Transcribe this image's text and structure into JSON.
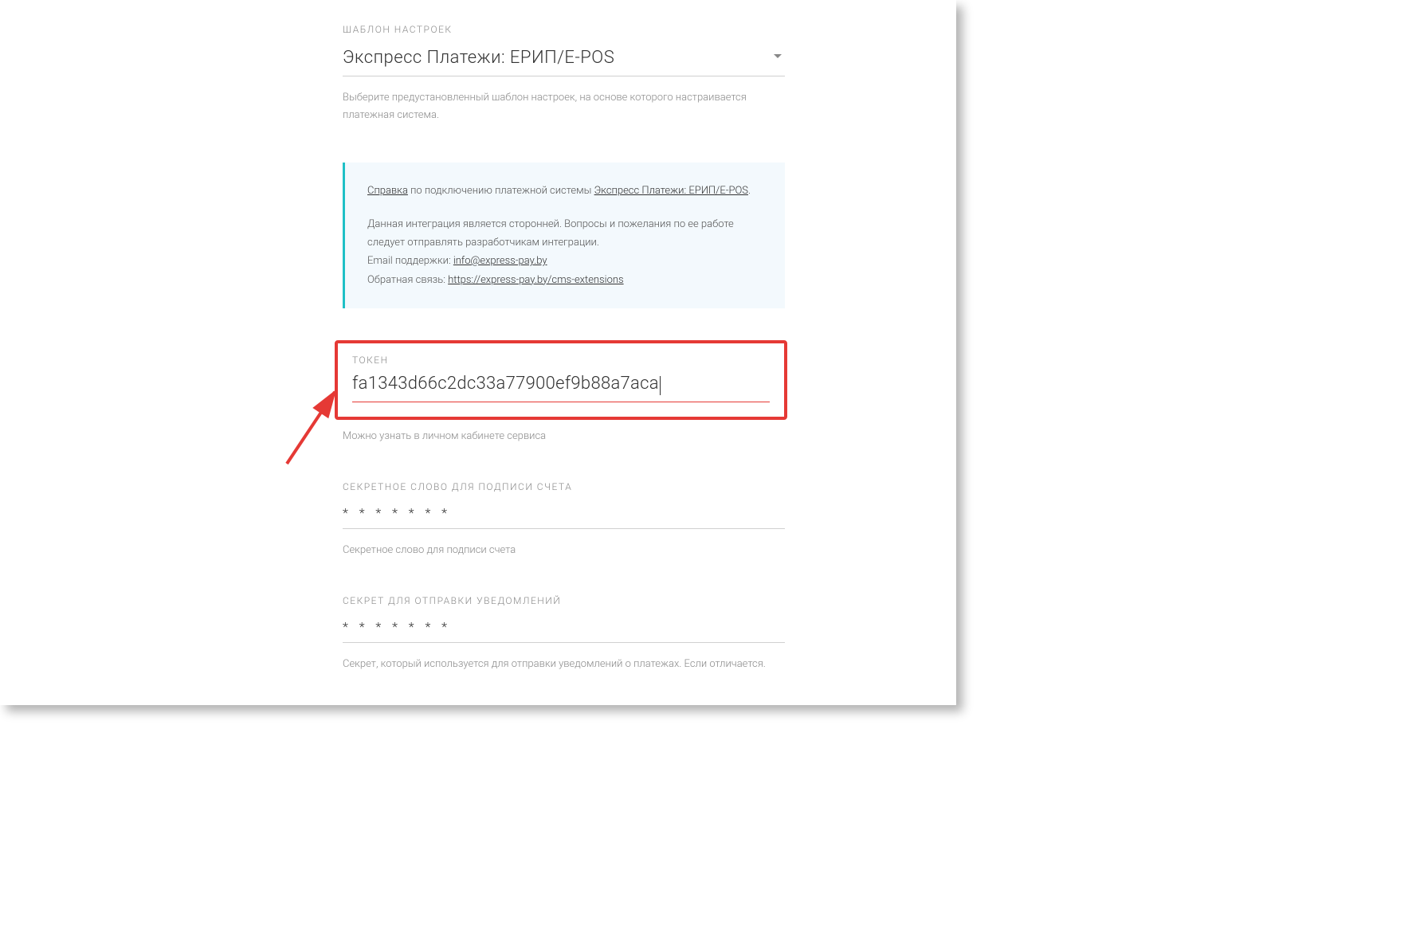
{
  "template": {
    "label": "ШАБЛОН НАСТРОЕК",
    "value": "Экспресс Платежи: ЕРИП/E-POS",
    "hint": "Выберите предустановленный шаблон настроек, на основе которого настраивается платежная система."
  },
  "infobox": {
    "line1_prefix": "Справка",
    "line1_mid": " по подключению платежной системы ",
    "line1_link": "Экспресс Платежи: ЕРИП/E-POS",
    "line1_suffix": ".",
    "line2": "Данная интеграция является сторонней. Вопросы и пожелания по ее работе следует отправлять разработчикам интеграции.",
    "line3_prefix": "Email поддержки: ",
    "line3_link": "info@express-pay.by",
    "line4_prefix": "Обратная связь: ",
    "line4_link": "https://express-pay.by/cms-extensions"
  },
  "token": {
    "label": "ТОКЕН",
    "value": "fa1343d66c2dc33a77900ef9b88a7aca",
    "hint": "Можно узнать в личном кабинете сервиса"
  },
  "secret_invoice": {
    "label": "СЕКРЕТНОЕ СЛОВО ДЛЯ ПОДПИСИ СЧЕТА",
    "value": "* * * * * * *",
    "hint": "Секретное слово для подписи счета"
  },
  "secret_notify": {
    "label": "СЕКРЕТ ДЛЯ ОТПРАВКИ УВЕДОМЛЕНИЙ",
    "value": "* * * * * * *",
    "hint": "Секрет, который используется для отправки уведомлений о платежах. Если отличается."
  }
}
